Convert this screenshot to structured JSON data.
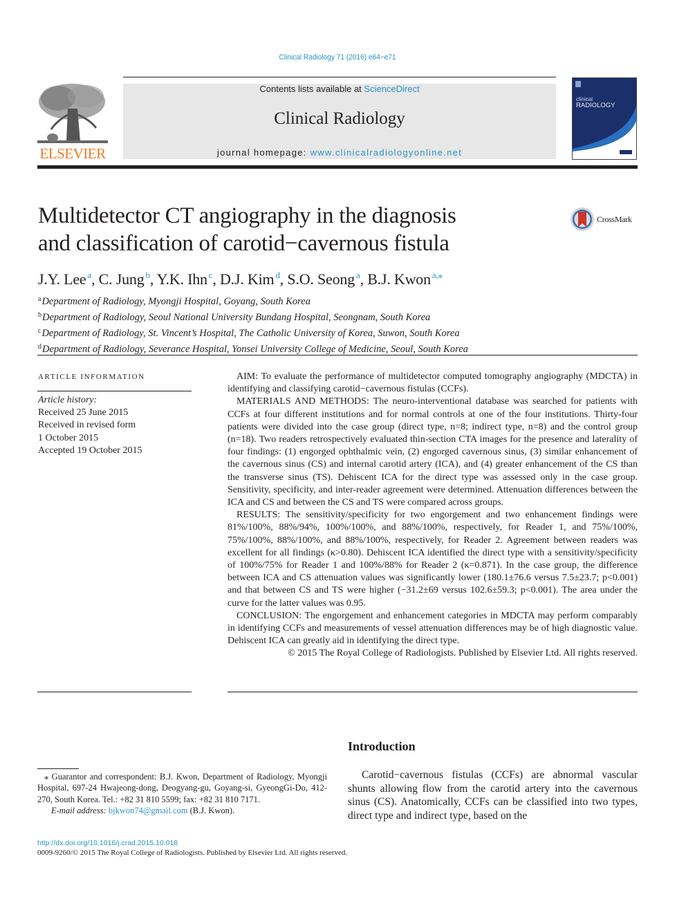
{
  "journal_ref": "Clinical Radiology 71 (2016) e64−e71",
  "masthead": {
    "contents_prefix": "Contents lists available at ",
    "contents_link": "ScienceDirect",
    "journal_title": "Clinical Radiology",
    "homepage_prefix": "journal homepage: ",
    "homepage_link": "www.clinicalradiologyonline.net",
    "publisher_logo_text": "ELSEVIER",
    "cover_title_small": "clinical",
    "cover_title_large": "RADIOLOGY",
    "brand_colors": {
      "link": "#2a93c1",
      "elsevier_orange": "#f07b1f",
      "cover_navy": "#1b2f6b",
      "cover_blue": "#2a6fc0"
    }
  },
  "crossmark_label": "CrossMark",
  "article": {
    "title_line1": "Multidetector CT angiography in the diagnosis",
    "title_line2": "and classification of carotid−cavernous fistula",
    "authors": [
      {
        "name": "J.Y. Lee",
        "sup": "a"
      },
      {
        "name": "C. Jung",
        "sup": "b"
      },
      {
        "name": "Y.K. Ihn",
        "sup": "c"
      },
      {
        "name": "D.J. Kim",
        "sup": "d"
      },
      {
        "name": "S.O. Seong",
        "sup": "a"
      },
      {
        "name": "B.J. Kwon",
        "sup": "a,⁎"
      }
    ],
    "affiliations": [
      {
        "key": "a",
        "text": "Department of Radiology, Myongji Hospital, Goyang, South Korea"
      },
      {
        "key": "b",
        "text": "Department of Radiology, Seoul National University Bundang Hospital, Seongnam, South Korea"
      },
      {
        "key": "c",
        "text": "Department of Radiology, St. Vincent’s Hospital, The Catholic University of Korea, Suwon, South Korea"
      },
      {
        "key": "d",
        "text": "Department of Radiology, Severance Hospital, Yonsei University College of Medicine, Seoul, South Korea"
      }
    ]
  },
  "article_info": {
    "heading": "ARTICLE INFORMATION",
    "history_label": "Article history:",
    "history": [
      "Received 25 June 2015",
      "Received in revised form",
      "1 October 2015",
      "Accepted 19 October 2015"
    ]
  },
  "abstract": {
    "aim": "AIM: To evaluate the performance of multidetector computed tomography angiography (MDCTA) in identifying and classifying carotid−cavernous fistulas (CCFs).",
    "methods": "MATERIALS AND METHODS: The neuro-interventional database was searched for patients with CCFs at four different institutions and for normal controls at one of the four institutions. Thirty-four patients were divided into the case group (direct type, n=8; indirect type, n=8) and the control group (n=18). Two readers retrospectively evaluated thin-section CTA images for the presence and laterality of four findings: (1) engorged ophthalmic vein, (2) engorged cavernous sinus, (3) similar enhancement of the cavernous sinus (CS) and internal carotid artery (ICA), and (4) greater enhancement of the CS than the transverse sinus (TS). Dehiscent ICA for the direct type was assessed only in the case group. Sensitivity, specificity, and inter-reader agreement were determined. Attenuation differences between the ICA and CS and between the CS and TS were compared across groups.",
    "results": "RESULTS: The sensitivity/specificity for two engorgement and two enhancement findings were 81%/100%, 88%/94%, 100%/100%, and 88%/100%, respectively, for Reader 1, and 75%/100%, 75%/100%, 88%/100%, and 88%/100%, respectively, for Reader 2. Agreement between readers was excellent for all findings (κ>0.80). Dehiscent ICA identified the direct type with a sensitivity/specificity of 100%/75% for Reader 1 and 100%/88% for Reader 2 (κ=0.871). In the case group, the difference between ICA and CS attenuation values was significantly lower (180.1±76.6 versus 7.5±23.7; p<0.001) and that between CS and TS were higher (−31.2±69 versus 102.6±59.3; p<0.001). The area under the curve for the latter values was 0.95.",
    "conclusion": "CONCLUSION: The engorgement and enhancement categories in MDCTA may perform comparably in identifying CCFs and measurements of vessel attenuation differences may be of high diagnostic value. Dehiscent ICA can greatly aid in identifying the direct type.",
    "copyright": "© 2015 The Royal College of Radiologists. Published by Elsevier Ltd. All rights reserved."
  },
  "footnote": {
    "correspondent": "⁎ Guarantor and correspondent: B.J. Kwon, Department of Radiology, Myongji Hospital, 697-24 Hwajeong-dong, Deogyang-gu, Goyang-si, GyeongGi-Do, 412-270, South Korea. Tel.: +82 31 810 5599; fax: +82 31 810 7171.",
    "email_label": "E-mail address: ",
    "email": "bjkwon74@gmail.com",
    "email_suffix": " (B.J. Kwon)."
  },
  "introduction": {
    "heading": "Introduction",
    "text": "Carotid−cavernous fistulas (CCFs) are abnormal vascular shunts allowing flow from the carotid artery into the cavernous sinus (CS). Anatomically, CCFs can be classified into two types, direct type and indirect type, based on the"
  },
  "bottom": {
    "doi": "http://dx.doi.org/10.1016/j.crad.2015.10.018",
    "issn": "0009-9260/© 2015 The Royal College of Radiologists. Published by Elsevier Ltd. All rights reserved."
  }
}
